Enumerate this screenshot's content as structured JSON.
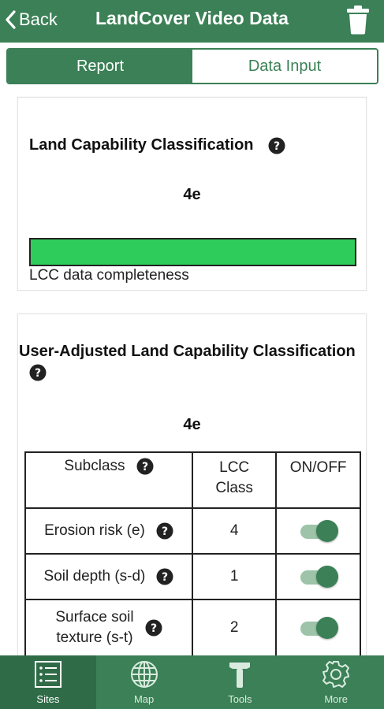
{
  "header": {
    "back_label": "Back",
    "title": "LandCover Video Data"
  },
  "tabs": [
    {
      "label": "Report",
      "active": true
    },
    {
      "label": "Data Input",
      "active": false
    }
  ],
  "lcc_card": {
    "title": "Land Capability Classification",
    "value": "4e",
    "completeness_label": "LCC data completeness",
    "completeness_fraction": 1.0,
    "completeness_color": "#2ecc5a"
  },
  "user_lcc_card": {
    "title": "User-Adjusted Land Capability Classification",
    "value": "4e",
    "table": {
      "headers": {
        "subclass": "Subclass",
        "lcc_class_line1": "LCC",
        "lcc_class_line2": "Class",
        "on_off": "ON/OFF"
      },
      "rows": [
        {
          "subclass": "Erosion risk (e)",
          "lcc_class": "4",
          "on": true
        },
        {
          "subclass": "Soil depth (s-d)",
          "lcc_class": "1",
          "on": true
        },
        {
          "subclass_line1": "Surface soil",
          "subclass_line2": "texture (s-t)",
          "lcc_class": "2",
          "on": true
        }
      ]
    }
  },
  "bottom_nav": [
    {
      "label": "Sites",
      "icon": "list-icon",
      "active": true
    },
    {
      "label": "Map",
      "icon": "globe-icon",
      "active": false
    },
    {
      "label": "Tools",
      "icon": "hammer-icon",
      "active": false
    },
    {
      "label": "More",
      "icon": "gear-icon",
      "active": false
    }
  ],
  "colors": {
    "brand_green": "#3b8056",
    "nav_active": "#2f6b47",
    "progress_fill": "#2ecc5a"
  }
}
